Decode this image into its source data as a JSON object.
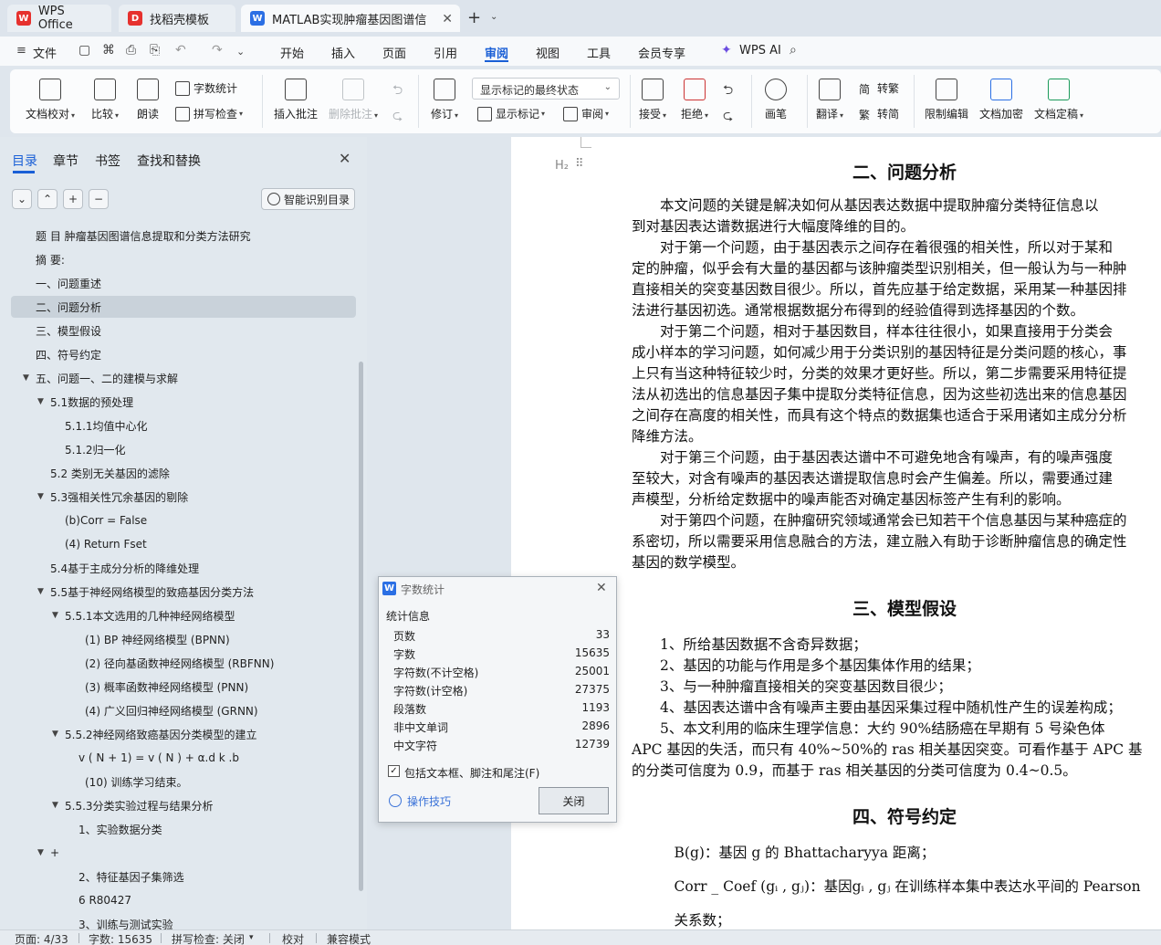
{
  "tabs": [
    {
      "label": "WPS Office",
      "icon": "wps-logo-icon",
      "color": "#e6312e"
    },
    {
      "label": "找稻壳模板",
      "icon": "docer-icon",
      "color": "#e6312e"
    },
    {
      "label": "MATLAB实现肿瘤基因图谱信",
      "icon": "writer-doc-icon",
      "color": "#2b6fe4"
    }
  ],
  "menu": {
    "file": "文件",
    "items": [
      "开始",
      "插入",
      "页面",
      "引用",
      "审阅",
      "视图",
      "工具",
      "会员专享"
    ],
    "active": "审阅",
    "ai": "WPS AI"
  },
  "ribbon": {
    "doc_check": "文档校对",
    "compare": "比较",
    "read_aloud": "朗读",
    "word_count": "字数统计",
    "spell_check": "拼写检查",
    "insert_comment": "插入批注",
    "delete_comment": "删除批注",
    "revise": "修订",
    "markup_state": "显示标记的最终状态",
    "show_markup": "显示标记",
    "review": "审阅",
    "accept": "接受",
    "reject": "拒绝",
    "pen": "画笔",
    "translate": "翻译",
    "to_traditional": "转繁",
    "to_simplified": "转简",
    "restrict_edit": "限制编辑",
    "doc_encrypt": "文档加密",
    "doc_finalize": "文档定稿"
  },
  "nav": {
    "tabs": [
      "目录",
      "章节",
      "书签",
      "查找和替换"
    ],
    "smart_toc": "智能识别目录",
    "items": [
      {
        "text": "题 目  肿瘤基因图谱信息提取和分类方法研究",
        "level": 0,
        "arrow": ""
      },
      {
        "text": "摘 要:",
        "level": 0,
        "arrow": ""
      },
      {
        "text": "一、问题重述",
        "level": 0,
        "arrow": ""
      },
      {
        "text": "二、问题分析",
        "level": 0,
        "arrow": "",
        "selected": true
      },
      {
        "text": "三、模型假设",
        "level": 0,
        "arrow": ""
      },
      {
        "text": "四、符号约定",
        "level": 0,
        "arrow": ""
      },
      {
        "text": "五、问题一、二的建模与求解",
        "level": 0,
        "arrow": "▼"
      },
      {
        "text": "5.1数据的预处理",
        "level": 1,
        "arrow": "▼"
      },
      {
        "text": "5.1.1均值中心化",
        "level": 2,
        "arrow": ""
      },
      {
        "text": "5.1.2归一化",
        "level": 2,
        "arrow": ""
      },
      {
        "text": "5.2 类别无关基因的滤除",
        "level": 1,
        "arrow": ""
      },
      {
        "text": "5.3强相关性冗余基因的剔除",
        "level": 1,
        "arrow": "▼"
      },
      {
        "text": "(b)Corr = False",
        "level": 2,
        "arrow": ""
      },
      {
        "text": "(4) Return Fset",
        "level": 2,
        "arrow": ""
      },
      {
        "text": "5.4基于主成分分析的降维处理",
        "level": 1,
        "arrow": ""
      },
      {
        "text": "5.5基于神经网络模型的致癌基因分类方法",
        "level": 1,
        "arrow": "▼"
      },
      {
        "text": "5.5.1本文选用的几种神经网络模型",
        "level": 2,
        "arrow": "▼"
      },
      {
        "text": "(1) BP 神经网络模型 (BPNN)",
        "level": 3,
        "arrow": ""
      },
      {
        "text": "(2) 径向基函数神经网络模型 (RBFNN)",
        "level": 3,
        "arrow": ""
      },
      {
        "text": "(3) 概率函数神经网络模型 (PNN)",
        "level": 3,
        "arrow": ""
      },
      {
        "text": "(4) 广义回归神经网络模型 (GRNN)",
        "level": 3,
        "arrow": ""
      },
      {
        "text": "5.5.2神经网络致癌基因分类模型的建立",
        "level": 2,
        "arrow": "▼"
      },
      {
        "text": "v ( N + 1) = v ( N ) + α.d k .b",
        "level": 3,
        "arrow": "",
        "indent": 86
      },
      {
        "text": "(10) 训练学习结束。",
        "level": 3,
        "arrow": "",
        "indent": 93
      },
      {
        "text": "5.5.3分类实验过程与结果分析",
        "level": 2,
        "arrow": "▼"
      },
      {
        "text": "1、实验数据分类",
        "level": 3,
        "arrow": "",
        "indent": 86
      },
      {
        "text": "+",
        "level": 1,
        "arrow": "▼",
        "indent": 55
      },
      {
        "text": "2、特征基因子集筛选",
        "level": 3,
        "arrow": "",
        "indent": 86
      },
      {
        "text": "6 R80427",
        "level": 3,
        "arrow": "",
        "indent": 86
      },
      {
        "text": "3、训练与测试实验",
        "level": 3,
        "arrow": "",
        "indent": 86
      }
    ]
  },
  "document": {
    "heading_mark": "H₂",
    "sections": [
      {
        "heading": "二、问题分析",
        "lines": [
          "　　本文问题的关键是解决如何从基因表达数据中提取肿瘤分类特征信息以",
          "到对基因表达谱数据进行大幅度降维的目的。",
          "　　对于第一个问题，由于基因表示之间存在着很强的相关性，所以对于某和",
          "定的肿瘤，似乎会有大量的基因都与该肿瘤类型识别相关，但一般认为与一种肿",
          "直接相关的突变基因数目很少。所以，首先应基于给定数据，采用某一种基因排",
          "法进行基因初选。通常根据数据分布得到的经验值得到选择基因的个数。",
          "　　对于第二个问题，相对于基因数目，样本往往很小，如果直接用于分类会",
          "成小样本的学习问题，如何减少用于分类识别的基因特征是分类问题的核心，事",
          "上只有当这种特征较少时，分类的效果才更好些。所以，第二步需要采用特征提",
          "法从初选出的信息基因子集中提取分类特征信息，因为这些初选出来的信息基因",
          "之间存在高度的相关性，而具有这个特点的数据集也适合于采用诸如主成分分析",
          "降维方法。",
          "　　对于第三个问题，由于基因表达谱中不可避免地含有噪声，有的噪声强度",
          "至较大，对含有噪声的基因表达谱提取信息时会产生偏差。所以，需要通过建",
          "声模型，分析给定数据中的噪声能否对确定基因标签产生有利的影响。",
          "　　对于第四个问题，在肿瘤研究领域通常会已知若干个信息基因与某种癌症的",
          "系密切，所以需要采用信息融合的方法，建立融入有助于诊断肿瘤信息的确定性",
          "基因的数学模型。"
        ]
      },
      {
        "heading": "三、模型假设",
        "lines": [
          "　　1、所给基因数据不含奇异数据；",
          "　　2、基因的功能与作用是多个基因集体作用的结果；",
          "　　3、与一种肿瘤直接相关的突变基因数目很少；",
          "　　4、基因表达谱中含有噪声主要由基因采集过程中随机性产生的误差构成；",
          "　　5、本文利用的临床生理学信息：大约 90%结肠癌在早期有 5 号染色体",
          "APC 基因的失活，而只有 40%~50%的 ras 相关基因突变。可看作基于 APC 基",
          "的分类可信度为 0.9，而基于 ras 相关基因的分类可信度为 0.4~0.5。"
        ]
      },
      {
        "heading": "四、符号约定",
        "lines": [
          "　　　B(g)：基因 g 的 Bhattacharyya 距离；",
          "　　　Corr _ Coef (gᵢ , gⱼ)：基因gᵢ , gⱼ 在训练样本集中表达水平间的 Pearson",
          "　　　关系数；"
        ]
      }
    ]
  },
  "dialog": {
    "title": "字数统计",
    "section": "统计信息",
    "rows": [
      {
        "label": "页数",
        "value": "33"
      },
      {
        "label": "字数",
        "value": "15635"
      },
      {
        "label": "字符数(不计空格)",
        "value": "25001"
      },
      {
        "label": "字符数(计空格)",
        "value": "27375"
      },
      {
        "label": "段落数",
        "value": "1193"
      },
      {
        "label": "非中文单词",
        "value": "2896"
      },
      {
        "label": "中文字符",
        "value": "12739"
      }
    ],
    "checkbox_label": "包括文本框、脚注和尾注(F)",
    "checkbox_checked": true,
    "tips": "操作技巧",
    "close_button": "关闭"
  },
  "status": {
    "page": "页面: 4/33",
    "words": "字数: 15635",
    "spell": "拼写检查: 关闭",
    "proof": "校对",
    "compat": "兼容模式"
  }
}
